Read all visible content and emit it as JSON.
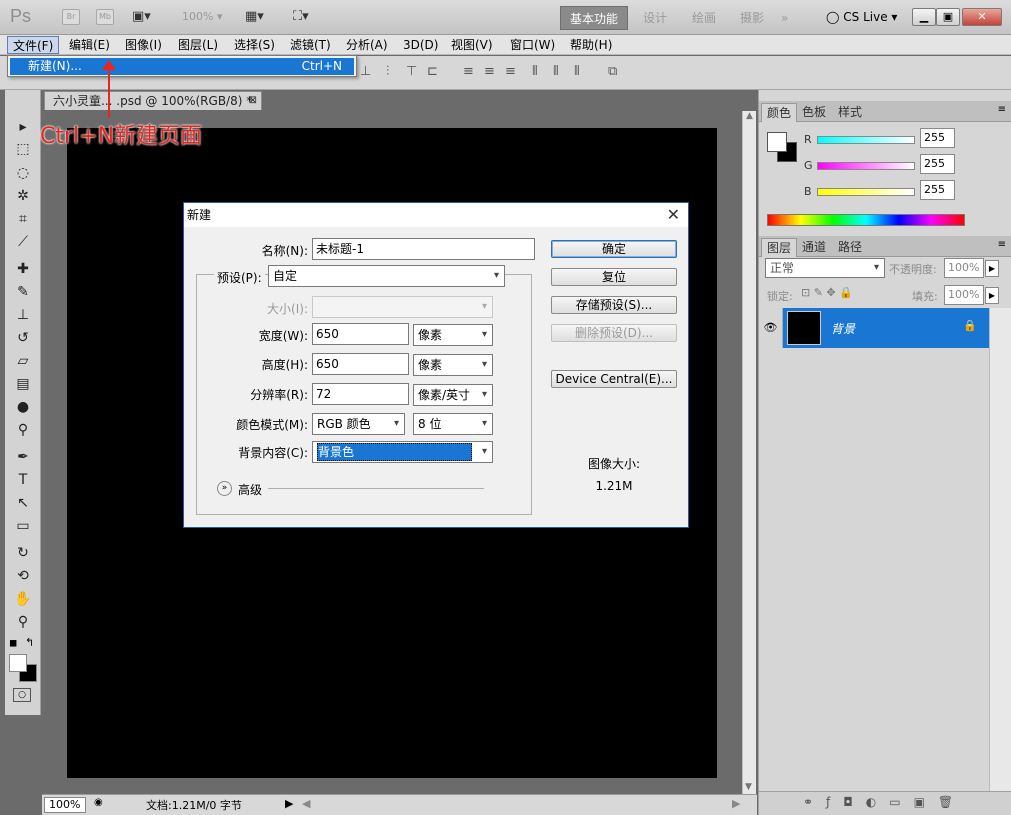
{
  "appbar": {
    "logo": "Ps",
    "br": "Br",
    "mb": "Mb",
    "zoom": "100%",
    "workspaces": [
      "基本功能",
      "设计",
      "绘画",
      "摄影"
    ],
    "more": "»",
    "cslive": "CS Live"
  },
  "menubar": [
    "文件(F)",
    "编辑(E)",
    "图像(I)",
    "图层(L)",
    "选择(S)",
    "滤镜(T)",
    "分析(A)",
    "3D(D)",
    "视图(V)",
    "窗口(W)",
    "帮助(H)"
  ],
  "dropdown": {
    "item": "新建(N)...",
    "shortcut": "Ctrl+N"
  },
  "document_tab": "六小灵童... .psd @ 100%(RGB/8) *",
  "annotation": "Ctrl+N新建页面",
  "statusbar": {
    "zoom": "100%",
    "doc": "文档:1.21M/0 字节"
  },
  "color_panel": {
    "tabs": [
      "颜色",
      "色板",
      "样式"
    ],
    "channels": [
      {
        "label": "R",
        "value": "255",
        "gradient": "#ff0000"
      },
      {
        "label": "G",
        "value": "255",
        "gradient": "#00ff00"
      },
      {
        "label": "B",
        "value": "255",
        "gradient": "#0000ff"
      }
    ]
  },
  "layers_panel": {
    "tabs": [
      "图层",
      "通道",
      "路径"
    ],
    "blend": "正常",
    "opacity_label": "不透明度:",
    "opacity": "100%",
    "lock_label": "锁定:",
    "fill_label": "填充:",
    "fill": "100%",
    "layer_name": "背景"
  },
  "dialog": {
    "title": "新建",
    "name_label": "名称(N):",
    "name_value": "未标题-1",
    "preset_label": "预设(P):",
    "preset_value": "自定",
    "size_label": "大小(I):",
    "width_label": "宽度(W):",
    "width_value": "650",
    "width_unit": "像素",
    "height_label": "高度(H):",
    "height_value": "650",
    "height_unit": "像素",
    "res_label": "分辨率(R):",
    "res_value": "72",
    "res_unit": "像素/英寸",
    "mode_label": "颜色模式(M):",
    "mode_value": "RGB 颜色",
    "bits_value": "8 位",
    "bg_label": "背景内容(C):",
    "bg_value": "背景色",
    "advanced": "高级",
    "buttons": {
      "ok": "确定",
      "reset": "复位",
      "save": "存储预设(S)...",
      "delete": "删除预设(D)...",
      "device": "Device Central(E)..."
    },
    "imgsize_label": "图像大小:",
    "imgsize_value": "1.21M"
  }
}
